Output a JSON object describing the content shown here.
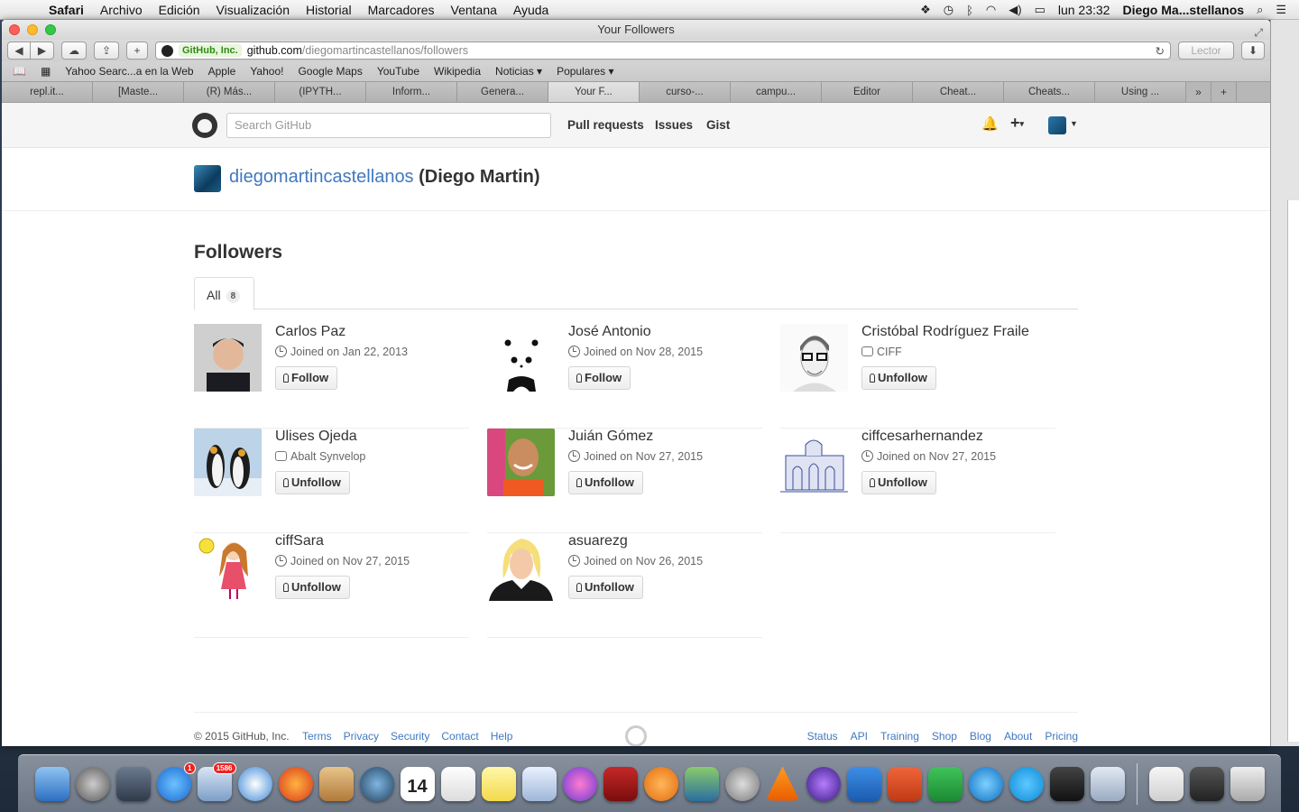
{
  "menubar": {
    "app": "Safari",
    "items": [
      "Archivo",
      "Edición",
      "Visualización",
      "Historial",
      "Marcadores",
      "Ventana",
      "Ayuda"
    ],
    "clock": "lun 23:32",
    "user": "Diego Ma...stellanos"
  },
  "window": {
    "title": "Your Followers",
    "url_ev": "GitHub, Inc.",
    "url_host": "github.com",
    "url_path": "/diegomartincastellanos/followers",
    "reader": "Lector"
  },
  "bookmarks": [
    "Yahoo Searc...a en la Web",
    "Apple",
    "Yahoo!",
    "Google Maps",
    "YouTube",
    "Wikipedia",
    "Noticias ▾",
    "Populares ▾"
  ],
  "tabs": [
    "repl.it...",
    "[Maste...",
    "(R) Más...",
    "(IPYTH...",
    "Inform...",
    "Genera...",
    "Your F...",
    "curso-...",
    "campu...",
    "Editor",
    "Cheat...",
    "Cheats...",
    "Using ..."
  ],
  "github": {
    "search_placeholder": "Search GitHub",
    "nav": [
      "Pull requests",
      "Issues",
      "Gist"
    ],
    "username": "diegomartincastellanos",
    "fullname": "(Diego Martin)",
    "section_title": "Followers",
    "tab_all": "All",
    "tab_all_count": "8",
    "followers": [
      {
        "name": "Carlos Paz",
        "meta": "Joined on Jan 22, 2013",
        "meta_type": "clock",
        "button": "Follow"
      },
      {
        "name": "José Antonio",
        "meta": "Joined on Nov 28, 2015",
        "meta_type": "clock",
        "button": "Follow"
      },
      {
        "name": "Cristóbal Rodríguez Fraile",
        "meta": "CIFF",
        "meta_type": "org",
        "button": "Unfollow"
      },
      {
        "name": "Ulises Ojeda",
        "meta": "Abalt Synvelop",
        "meta_type": "org",
        "button": "Unfollow"
      },
      {
        "name": "Juián Gómez",
        "meta": "Joined on Nov 27, 2015",
        "meta_type": "clock",
        "button": "Unfollow"
      },
      {
        "name": "ciffcesarhernandez",
        "meta": "Joined on Nov 27, 2015",
        "meta_type": "clock",
        "button": "Unfollow"
      },
      {
        "name": "ciffSara",
        "meta": "Joined on Nov 27, 2015",
        "meta_type": "clock",
        "button": "Unfollow"
      },
      {
        "name": "asuarezg",
        "meta": "Joined on Nov 26, 2015",
        "meta_type": "clock",
        "button": "Unfollow"
      }
    ],
    "footer": {
      "copyright": "© 2015 GitHub, Inc.",
      "left_links": [
        "Terms",
        "Privacy",
        "Security",
        "Contact",
        "Help"
      ],
      "right_links": [
        "Status",
        "API",
        "Training",
        "Shop",
        "Blog",
        "About",
        "Pricing"
      ]
    }
  },
  "dock": {
    "appstore_badge": "1",
    "mail_badge": "1586",
    "calendar_day": "14"
  }
}
